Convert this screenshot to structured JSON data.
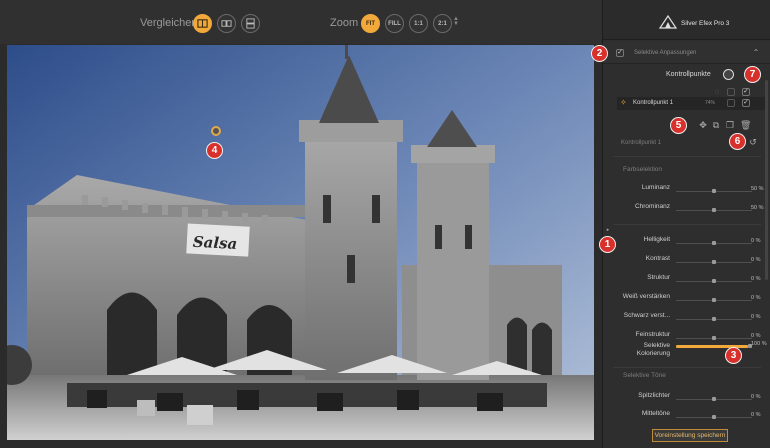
{
  "toolbar": {
    "compare_label": "Vergleichen",
    "zoom_label": "Zoom",
    "zoom_fit": "FIT",
    "zoom_fill": "FILL",
    "zoom_1_1": "1:1",
    "zoom_2_1": "2:1"
  },
  "photo": {
    "sign_text": "Salsa"
  },
  "panel": {
    "brand": "Silver Efex Pro 3",
    "section_title": "Selektive Anpassungen",
    "control_points_title": "Kontrollpunkte",
    "control_point_name": "Kontrollpunkt 1",
    "control_point_opacity": "74%",
    "selected_point_label": "Kontrollpunkt 1",
    "color_selection_title": "Farbselektion",
    "sliders_color": [
      {
        "label": "Luminanz",
        "value": "50 %",
        "level": 0.5
      },
      {
        "label": "Chrominanz",
        "value": "50 %",
        "level": 0.5
      }
    ],
    "sliders_adjust": [
      {
        "label": "Helligkeit",
        "value": "0 %",
        "level": 0.5
      },
      {
        "label": "Kontrast",
        "value": "0 %",
        "level": 0.5
      },
      {
        "label": "Struktur",
        "value": "0 %",
        "level": 0.5
      },
      {
        "label": "Weiß verstärken",
        "value": "0 %",
        "level": 0.5
      },
      {
        "label": "Schwarz verst...",
        "value": "0 %",
        "level": 0.5
      },
      {
        "label": "Feinstruktur",
        "value": "0 %",
        "level": 0.5
      }
    ],
    "selective_coloring": {
      "label_line1": "Selektive",
      "label_line2": "Kolorierung",
      "value": "100 %",
      "level": 1.0
    },
    "selective_tones_title": "Selektive Töne",
    "sliders_tones": [
      {
        "label": "Spitzlichter",
        "value": "0 %",
        "level": 0.5
      },
      {
        "label": "Mitteltöne",
        "value": "0 %",
        "level": 0.5
      }
    ],
    "preset_button": "Voreinstellung speichern"
  },
  "callouts": [
    "1",
    "2",
    "3",
    "4",
    "5",
    "6",
    "7"
  ],
  "colors": {
    "accent": "#f2a93b",
    "callout": "#d8312c",
    "panel_bg": "#2e2e2e"
  }
}
